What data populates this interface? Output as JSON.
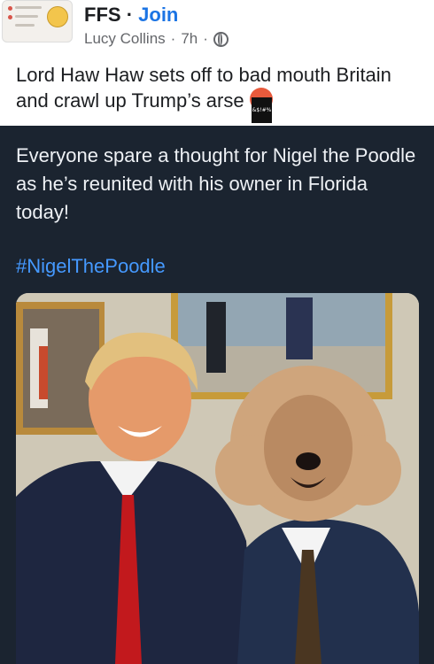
{
  "group": {
    "name": "FFS",
    "separator": "·",
    "join_label": "Join"
  },
  "post": {
    "author": "Lucy Collins",
    "time": "7h",
    "dot": "·",
    "audience_icon": "globe-icon",
    "caption": "Lord Haw Haw sets off to bad mouth Britain and crawl up Trump’s arse",
    "emoji_icon": "swearing-face-emoji"
  },
  "shared": {
    "text": "Everyone spare a thought for Nigel the Poodle as he’s reunited with his owner in Florida today!",
    "hashtag": "#NigelThePoodle",
    "image_icon": "photo-image"
  },
  "colors": {
    "card_bg": "#1b2430",
    "link_blue": "#1b74e4",
    "hashtag_blue": "#4599ff"
  }
}
